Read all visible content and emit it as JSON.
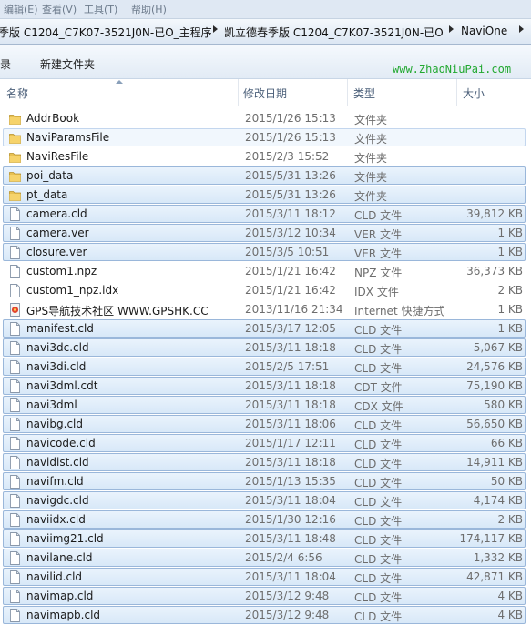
{
  "menubar": {
    "items": [
      "编辑(E)",
      "查看(V)",
      "工具(T)",
      "帮助(H)"
    ]
  },
  "breadcrumb": {
    "items": [
      "季版 C1204_C7K07-3521J0N-已O_主程序",
      "凯立德春季版 C1204_C7K07-3521J0N-已O",
      "NaviOne"
    ]
  },
  "toolbar": {
    "left_label": "录",
    "new_folder_label": "新建文件夹",
    "watermark": "www.ZhaoNiuPai.com"
  },
  "columns": {
    "name": "名称",
    "date": "修改日期",
    "type": "类型",
    "size": "大小"
  },
  "files": [
    {
      "name": "AddrBook",
      "date": "2015/1/26 15:13",
      "type": "文件夹",
      "size": "",
      "icon": "folder-icon",
      "state": "none"
    },
    {
      "name": "NaviParamsFile",
      "date": "2015/1/26 15:13",
      "type": "文件夹",
      "size": "",
      "icon": "folder-icon",
      "state": "light"
    },
    {
      "name": "NaviResFile",
      "date": "2015/2/3 15:52",
      "type": "文件夹",
      "size": "",
      "icon": "folder-icon",
      "state": "none"
    },
    {
      "name": "poi_data",
      "date": "2015/5/31 13:26",
      "type": "文件夹",
      "size": "",
      "icon": "folder-icon",
      "state": "sel"
    },
    {
      "name": "pt_data",
      "date": "2015/5/31 13:26",
      "type": "文件夹",
      "size": "",
      "icon": "folder-icon",
      "state": "sel"
    },
    {
      "name": "camera.cld",
      "date": "2015/3/11 18:12",
      "type": "CLD 文件",
      "size": "39,812 KB",
      "icon": "file-icon",
      "state": "sel"
    },
    {
      "name": "camera.ver",
      "date": "2015/3/12 10:34",
      "type": "VER 文件",
      "size": "1 KB",
      "icon": "file-icon",
      "state": "sel"
    },
    {
      "name": "closure.ver",
      "date": "2015/3/5 10:51",
      "type": "VER 文件",
      "size": "1 KB",
      "icon": "file-icon",
      "state": "sel"
    },
    {
      "name": "custom1.npz",
      "date": "2015/1/21 16:42",
      "type": "NPZ 文件",
      "size": "36,373 KB",
      "icon": "file-icon",
      "state": "none"
    },
    {
      "name": "custom1_npz.idx",
      "date": "2015/1/21 16:42",
      "type": "IDX 文件",
      "size": "2 KB",
      "icon": "file-icon",
      "state": "none"
    },
    {
      "name": "GPS导航技术社区 WWW.GPSHK.CC",
      "date": "2013/11/16 21:34",
      "type": "Internet 快捷方式",
      "size": "1 KB",
      "icon": "internet-shortcut-icon",
      "state": "none"
    },
    {
      "name": "manifest.cld",
      "date": "2015/3/17 12:05",
      "type": "CLD 文件",
      "size": "1 KB",
      "icon": "file-icon",
      "state": "sel"
    },
    {
      "name": "navi3dc.cld",
      "date": "2015/3/11 18:18",
      "type": "CLD 文件",
      "size": "5,067 KB",
      "icon": "file-icon",
      "state": "sel"
    },
    {
      "name": "navi3di.cld",
      "date": "2015/2/5 17:51",
      "type": "CLD 文件",
      "size": "24,576 KB",
      "icon": "file-icon",
      "state": "sel"
    },
    {
      "name": "navi3dml.cdt",
      "date": "2015/3/11 18:18",
      "type": "CDT 文件",
      "size": "75,190 KB",
      "icon": "file-icon",
      "state": "sel"
    },
    {
      "name": "navi3dml",
      "date": "2015/3/11 18:18",
      "type": "CDX 文件",
      "size": "580 KB",
      "icon": "file-icon",
      "state": "sel"
    },
    {
      "name": "navibg.cld",
      "date": "2015/3/11 18:06",
      "type": "CLD 文件",
      "size": "56,650 KB",
      "icon": "file-icon",
      "state": "sel"
    },
    {
      "name": "navicode.cld",
      "date": "2015/1/17 12:11",
      "type": "CLD 文件",
      "size": "66 KB",
      "icon": "file-icon",
      "state": "sel"
    },
    {
      "name": "navidist.cld",
      "date": "2015/3/11 18:18",
      "type": "CLD 文件",
      "size": "14,911 KB",
      "icon": "file-icon",
      "state": "sel"
    },
    {
      "name": "navifm.cld",
      "date": "2015/1/13 15:35",
      "type": "CLD 文件",
      "size": "50 KB",
      "icon": "file-icon",
      "state": "sel"
    },
    {
      "name": "navigdc.cld",
      "date": "2015/3/11 18:04",
      "type": "CLD 文件",
      "size": "4,174 KB",
      "icon": "file-icon",
      "state": "sel"
    },
    {
      "name": "naviidx.cld",
      "date": "2015/1/30 12:16",
      "type": "CLD 文件",
      "size": "2 KB",
      "icon": "file-icon",
      "state": "sel"
    },
    {
      "name": "naviimg21.cld",
      "date": "2015/3/11 18:48",
      "type": "CLD 文件",
      "size": "174,117 KB",
      "icon": "file-icon",
      "state": "sel"
    },
    {
      "name": "navilane.cld",
      "date": "2015/2/4 6:56",
      "type": "CLD 文件",
      "size": "1,332 KB",
      "icon": "file-icon",
      "state": "sel"
    },
    {
      "name": "navilid.cld",
      "date": "2015/3/11 18:04",
      "type": "CLD 文件",
      "size": "42,871 KB",
      "icon": "file-icon",
      "state": "sel"
    },
    {
      "name": "navimap.cld",
      "date": "2015/3/12 9:48",
      "type": "CLD 文件",
      "size": "4 KB",
      "icon": "file-icon",
      "state": "sel"
    },
    {
      "name": "navimapb.cld",
      "date": "2015/3/12 9:48",
      "type": "CLD 文件",
      "size": "4 KB",
      "icon": "file-icon",
      "state": "sel"
    }
  ]
}
